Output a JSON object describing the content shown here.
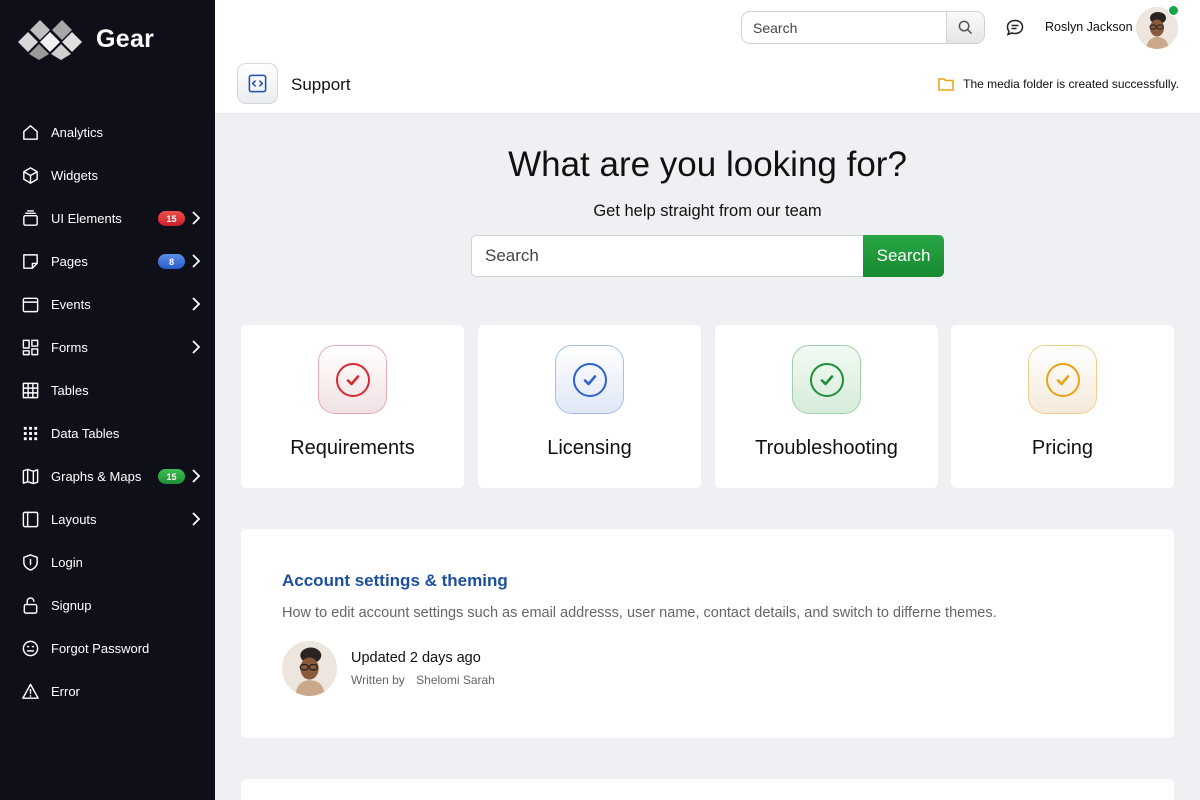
{
  "app": {
    "logo_text": "Gear"
  },
  "sidebar": {
    "items": [
      {
        "label": "Analytics",
        "icon": "home-icon"
      },
      {
        "label": "Widgets",
        "icon": "cube-icon"
      },
      {
        "label": "UI Elements",
        "icon": "layers-icon",
        "badge": "15",
        "badge_color": "#d92a32"
      },
      {
        "label": "Pages",
        "icon": "pages-icon",
        "badge": "8",
        "badge_color": "#2f62cc"
      },
      {
        "label": "Events",
        "icon": "calendar-icon"
      },
      {
        "label": "Forms",
        "icon": "forms-icon"
      },
      {
        "label": "Tables",
        "icon": "table-icon"
      },
      {
        "label": "Data Tables",
        "icon": "grid-dots-icon"
      },
      {
        "label": "Graphs & Maps",
        "icon": "map-icon",
        "badge": "15",
        "badge_color": "#1f9a38"
      },
      {
        "label": "Layouts",
        "icon": "layout-icon"
      },
      {
        "label": "Login",
        "icon": "shield-icon"
      },
      {
        "label": "Signup",
        "icon": "lock-icon"
      },
      {
        "label": "Forgot Password",
        "icon": "face-icon"
      },
      {
        "label": "Error",
        "icon": "warning-icon"
      }
    ]
  },
  "header": {
    "search_placeholder": "Search",
    "user_name": "Roslyn Jackson",
    "page_title": "Support",
    "notice": "The media folder is created successfully.",
    "notice_color": "#e8a317"
  },
  "hero": {
    "title": "What are you looking for?",
    "subtitle": "Get help straight from our team",
    "search_placeholder": "Search",
    "search_button": "Search",
    "button_color": "#1f9a38"
  },
  "categories": [
    {
      "label": "Requirements",
      "color": "#d92a32"
    },
    {
      "label": "Licensing",
      "color": "#2f62cc"
    },
    {
      "label": "Troubleshooting",
      "color": "#1f8f38"
    },
    {
      "label": "Pricing",
      "color": "#e8a317"
    }
  ],
  "article": {
    "title": "Account settings & theming",
    "description": "How to edit account settings such as email addresss, user name, contact details, and switch to differne themes.",
    "updated": "Updated 2 days ago",
    "written_by_label": "Written by",
    "author": "Shelomi Sarah"
  }
}
